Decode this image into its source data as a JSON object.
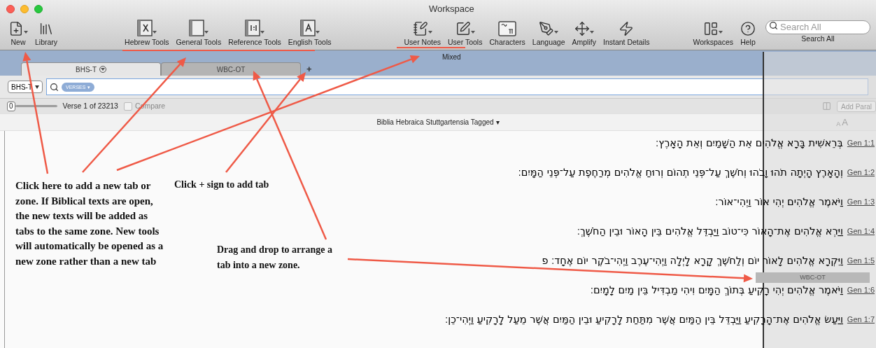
{
  "window": {
    "title": "Workspace"
  },
  "toolbar": {
    "groups": [
      [
        {
          "label": "New",
          "kind": "new",
          "menu": true
        },
        {
          "label": "Library",
          "kind": "library",
          "menu": false
        }
      ],
      [
        {
          "label": "Hebrew Tools",
          "kind": "hebrew",
          "menu": true
        },
        {
          "label": "General Tools",
          "kind": "book",
          "menu": true
        },
        {
          "label": "Reference Tools",
          "kind": "reference",
          "menu": true
        },
        {
          "label": "English Tools",
          "kind": "english",
          "menu": true
        }
      ],
      [
        {
          "label": "User Notes",
          "kind": "notes",
          "menu": true
        },
        {
          "label": "User Tools",
          "kind": "pencil",
          "menu": true
        },
        {
          "label": "Characters",
          "kind": "characters",
          "menu": false
        },
        {
          "label": "Language",
          "kind": "language",
          "menu": true
        },
        {
          "label": "Amplify",
          "kind": "amplify",
          "menu": true
        },
        {
          "label": "Instant Details",
          "kind": "bolt",
          "menu": false
        }
      ],
      [
        {
          "label": "Workspaces",
          "kind": "workspaces",
          "menu": true
        },
        {
          "label": "Help",
          "kind": "help",
          "menu": false
        }
      ]
    ],
    "search": {
      "placeholder": "Search All",
      "label": "Search All"
    }
  },
  "zone": {
    "label": "Mixed",
    "tabs": [
      {
        "label": "BHS-T",
        "selected": true
      },
      {
        "label": "WBC-OT",
        "selected": false
      }
    ],
    "add_tab": "+"
  },
  "search_row": {
    "module": "BHS-T",
    "token": "VERSES",
    "token_caret": "▾"
  },
  "nav_row": {
    "slider_value": "0",
    "verse": "Verse 1 of 23213",
    "compare": {
      "label": "Compare",
      "checked": false,
      "disabled": true
    },
    "add_parallel": "Add Paral"
  },
  "text_pane": {
    "title": "Biblia Hebraica Stuttgartensia Tagged",
    "title_caret": "▾",
    "size_small": "A",
    "size_large": "A",
    "verses": [
      {
        "text": "בְּרֵאשִׁית בָּרָא אֱלֹהִים אֵת הַשָּׁמַיִם וְאֵת הָאָרֶץ׃",
        "ref": "Gen 1:1"
      },
      {
        "text": "וְהָאָרֶץ הָיְתָה תֹהוּ וָבֹהוּ וְחֹשֶׁךְ עַל־פְּנֵי תְהוֹם וְרוּחַ אֱלֹהִים מְרַחֶפֶת עַל־פְּנֵי הַמָּיִם׃",
        "ref": "Gen 1:2"
      },
      {
        "text": "וַיֹּאמֶר אֱלֹהִים יְהִי אוֹר וַיְהִי־אוֹר׃",
        "ref": "Gen 1:3"
      },
      {
        "text": "וַיַּרְא אֱלֹהִים אֶת־הָאוֹר כִּי־טוֹב וַיַּבְדֵּל אֱלֹהִים בֵּין הָאוֹר וּבֵין הַחֹשֶׁךְ׃",
        "ref": "Gen 1:4"
      },
      {
        "text": "וַיִּקְרָא אֱלֹהִים לָאוֹר יוֹם וְלַחֹשֶׁךְ קָרָא לָיְלָה וַיְהִי־עֶרֶב וַיְהִי־בֹקֶר יוֹם אֶחָד׃ פ",
        "ref": "Gen 1:5"
      },
      {
        "text": "וַיֹּאמֶר אֱלֹהִים יְהִי רָקִיעַ בְּתוֹךְ הַמָּיִם וִיהִי מַבְדִּיל בֵּין מַיִם לָמָיִם׃",
        "ref": "Gen 1:6"
      },
      {
        "text": "וַיַּעַשׂ אֱלֹהִים אֶת־הָרָקִיעַ וַיַּבְדֵּל בֵּין הַמַּיִם אֲשֶׁר מִתַּחַת לָרָקִיעַ וּבֵין הַמַּיִם אֲשֶׁר מֵעַל לָרָקִיעַ וַיְהִי־כֵן׃",
        "ref": "Gen 1:7"
      }
    ]
  },
  "drag_ghost": {
    "label": "WBC-OT"
  },
  "annotations": [
    {
      "text": "Click here to add a new tab or zone. If Biblical texts are open, the new texts will be added as tabs to the same zone. New tools will automatically be opened as a new zone rather than a new tab"
    },
    {
      "text": "Click + sign to add tab"
    },
    {
      "text": "Drag and drop to arrange a tab into a new zone."
    }
  ]
}
